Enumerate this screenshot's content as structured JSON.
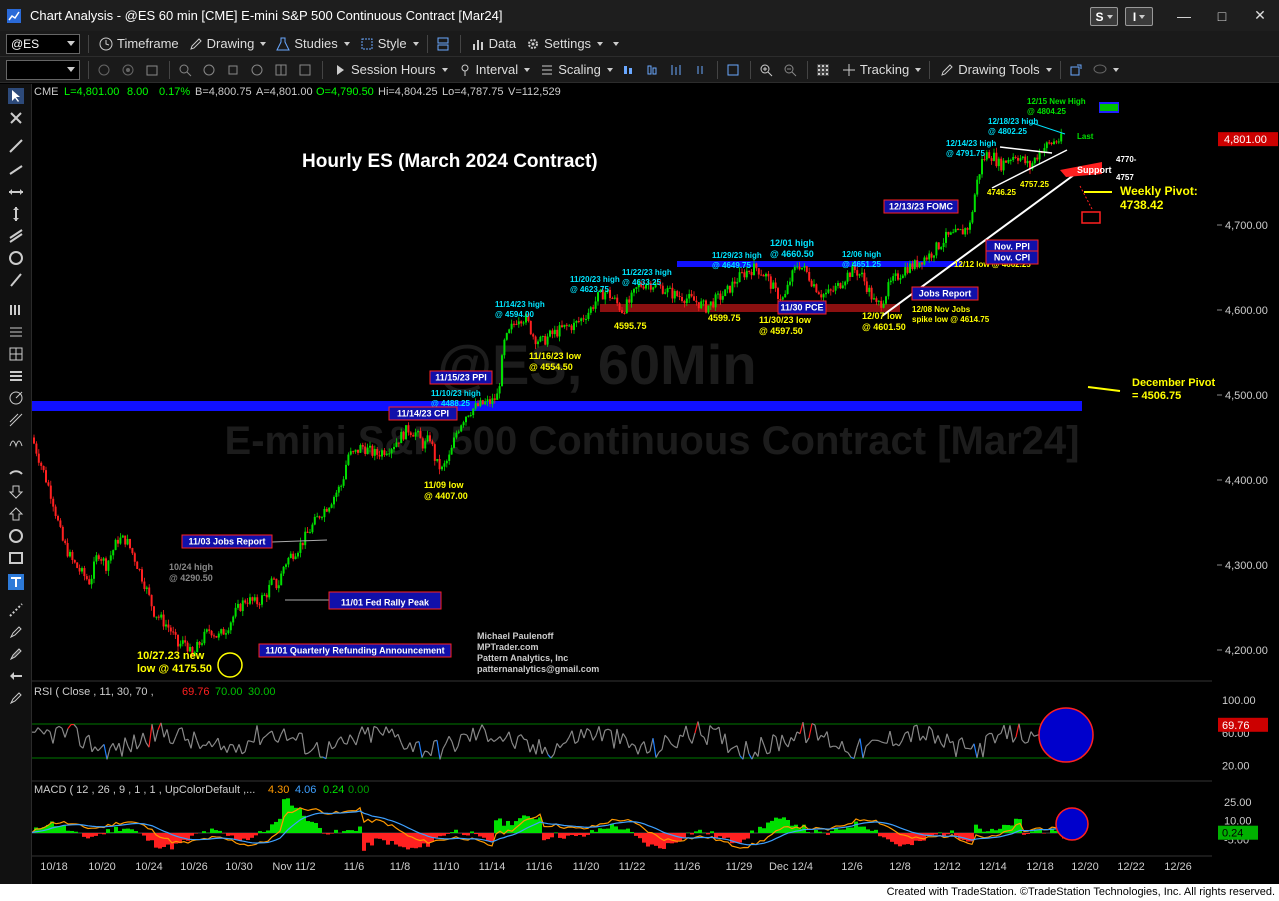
{
  "window": {
    "title": "Chart Analysis - @ES 60 min [CME] E-mini S&P 500 Continuous Contract [Mar24]",
    "s_button": "S",
    "i_button": "I"
  },
  "toolbar1": {
    "symbol": "@ES",
    "timeframe": "Timeframe",
    "drawing": "Drawing",
    "studies": "Studies",
    "style": "Style",
    "data": "Data",
    "settings": "Settings"
  },
  "toolbar2": {
    "session_hours": "Session Hours",
    "interval": "Interval",
    "scaling": "Scaling",
    "tracking": "Tracking",
    "drawing_tools": "Drawing Tools"
  },
  "header": {
    "exchange": "CME",
    "last": "L=4,801.00",
    "change": "8.00",
    "pct": "0.17%",
    "bid": "B=4,800.75",
    "ask": "A=4,801.00",
    "open": "O=4,790.50",
    "high": "Hi=4,804.25",
    "low": "Lo=4,787.75",
    "volume": "V=112,529"
  },
  "watermark": {
    "line1": "@ES, 60Min",
    "line2": "E-mini S&P 500 Continuous Contract [Mar24]"
  },
  "chart_data": {
    "type": "candlestick",
    "title": "Hourly ES (March 2024 Contract)",
    "price_axis": {
      "ticks": [
        "4,700.00",
        "4,600.00",
        "4,500.00",
        "4,400.00",
        "4,300.00",
        "4,200.00"
      ],
      "last_label": "4,801.00"
    },
    "x_axis_ticks": [
      "10/18",
      "10/20",
      "10/24",
      "10/26",
      "10/30",
      "Nov 11/2",
      "11/6",
      "11/8",
      "11/10",
      "11/14",
      "11/16",
      "11/20",
      "11/22",
      "11/26",
      "11/29",
      "Dec 12/4",
      "12/6",
      "12/8",
      "12/12",
      "12/14",
      "12/18",
      "12/20",
      "12/22",
      "12/26"
    ],
    "price_path": [
      [
        0,
        4450
      ],
      [
        10,
        4415
      ],
      [
        20,
        4380
      ],
      [
        30,
        4330
      ],
      [
        40,
        4305
      ],
      [
        50,
        4290
      ],
      [
        58,
        4280
      ],
      [
        66,
        4315
      ],
      [
        74,
        4300
      ],
      [
        86,
        4330
      ],
      [
        94,
        4330
      ],
      [
        102,
        4310
      ],
      [
        112,
        4280
      ],
      [
        122,
        4245
      ],
      [
        130,
        4235
      ],
      [
        138,
        4225
      ],
      [
        146,
        4205
      ],
      [
        154,
        4210
      ],
      [
        160,
        4190
      ],
      [
        166,
        4205
      ],
      [
        172,
        4215
      ],
      [
        178,
        4225
      ],
      [
        186,
        4215
      ],
      [
        194,
        4225
      ],
      [
        204,
        4245
      ],
      [
        214,
        4260
      ],
      [
        224,
        4255
      ],
      [
        234,
        4265
      ],
      [
        240,
        4280
      ],
      [
        246,
        4275
      ],
      [
        252,
        4300
      ],
      [
        258,
        4310
      ],
      [
        266,
        4320
      ],
      [
        272,
        4330
      ],
      [
        280,
        4345
      ],
      [
        288,
        4360
      ],
      [
        296,
        4370
      ],
      [
        304,
        4385
      ],
      [
        310,
        4395
      ],
      [
        316,
        4430
      ],
      [
        322,
        4430
      ],
      [
        330,
        4440
      ],
      [
        336,
        4435
      ],
      [
        344,
        4430
      ],
      [
        352,
        4435
      ],
      [
        360,
        4440
      ],
      [
        368,
        4450
      ],
      [
        376,
        4460
      ],
      [
        384,
        4455
      ],
      [
        392,
        4440
      ],
      [
        398,
        4450
      ],
      [
        404,
        4420
      ],
      [
        410,
        4412
      ],
      [
        418,
        4428
      ],
      [
        424,
        4455
      ],
      [
        430,
        4470
      ],
      [
        436,
        4480
      ],
      [
        444,
        4486
      ],
      [
        452,
        4490
      ],
      [
        460,
        4492
      ],
      [
        466,
        4500
      ],
      [
        472,
        4560
      ],
      [
        480,
        4580
      ],
      [
        486,
        4592
      ],
      [
        494,
        4590
      ],
      [
        502,
        4568
      ],
      [
        510,
        4562
      ],
      [
        518,
        4570
      ],
      [
        526,
        4575
      ],
      [
        534,
        4580
      ],
      [
        542,
        4582
      ],
      [
        550,
        4590
      ],
      [
        558,
        4600
      ],
      [
        566,
        4615
      ],
      [
        574,
        4622
      ],
      [
        582,
        4612
      ],
      [
        590,
        4600
      ],
      [
        598,
        4610
      ],
      [
        606,
        4628
      ],
      [
        614,
        4632
      ],
      [
        622,
        4630
      ],
      [
        632,
        4625
      ],
      [
        642,
        4618
      ],
      [
        652,
        4615
      ],
      [
        664,
        4610
      ],
      [
        674,
        4603
      ],
      [
        684,
        4612
      ],
      [
        694,
        4620
      ],
      [
        704,
        4635
      ],
      [
        714,
        4645
      ],
      [
        724,
        4650
      ],
      [
        734,
        4640
      ],
      [
        744,
        4620
      ],
      [
        752,
        4612
      ],
      [
        758,
        4635
      ],
      [
        766,
        4655
      ],
      [
        774,
        4645
      ],
      [
        782,
        4630
      ],
      [
        790,
        4618
      ],
      [
        798,
        4620
      ],
      [
        806,
        4628
      ],
      [
        814,
        4640
      ],
      [
        822,
        4648
      ],
      [
        830,
        4640
      ],
      [
        838,
        4620
      ],
      [
        844,
        4605
      ],
      [
        850,
        4610
      ],
      [
        858,
        4630
      ],
      [
        866,
        4640
      ],
      [
        874,
        4650
      ],
      [
        882,
        4652
      ],
      [
        890,
        4660
      ],
      [
        898,
        4665
      ],
      [
        906,
        4675
      ],
      [
        914,
        4685
      ],
      [
        922,
        4688
      ],
      [
        930,
        4692
      ],
      [
        938,
        4700
      ],
      [
        944,
        4745
      ],
      [
        950,
        4775
      ],
      [
        956,
        4785
      ],
      [
        962,
        4780
      ],
      [
        968,
        4770
      ],
      [
        976,
        4778
      ],
      [
        984,
        4783
      ],
      [
        992,
        4775
      ],
      [
        998,
        4768
      ],
      [
        1004,
        4780
      ],
      [
        1010,
        4790
      ],
      [
        1016,
        4794
      ],
      [
        1022,
        4798
      ],
      [
        1030,
        4801
      ]
    ],
    "annotations": {
      "a_1215_high": "12/15 New High\n@ 4804.25",
      "a_1218_high": "12/18/23 high\n@ 4802.25",
      "a_1214_high": "12/14/23 high\n@ 4791.75",
      "a_last": "Last",
      "a_4770": "4770-",
      "a_4757": "4757",
      "a_support": "Support",
      "a_4746": "4746.25",
      "a_47572": "4757.25",
      "a_weekly_pivot": "Weekly Pivot:\n4738.42",
      "a_fomc": "12/13/23 FOMC",
      "a_nov_ppi": "Nov. PPI",
      "a_nov_cpi": "Nov. CPI",
      "a_1212_low": "12/12 low @ 4662.25",
      "a_1201_high": "12/01 high\n@ 4660.50",
      "a_1206_high": "12/06 high\n@ 4651.25",
      "a_1129_high": "11/29/23 high\n@ 4649.75",
      "a_1120_high": "11/20/23 high\n@ 4623.75",
      "a_1122_high": "11/22/23 high\n@ 4633.25",
      "a_1114_high": "11/14/23 high\n@ 4594.00",
      "a_jobs_report": "Jobs Report",
      "a_1130_pce": "11/30 PCE",
      "a_4595": "4595.75",
      "a_4599": "4599.75",
      "a_1130_low": "11/30/23 low\n@ 4597.50",
      "a_1207_low": "12/07 low\n@ 4601.50",
      "a_1208_jobs": "12/08 Nov Jobs\nspike low @ 4614.75",
      "a_1116_low": "11/16/23 low\n@ 4554.50",
      "a_1115_ppi": "11/15/23 PPI",
      "a_1110_high": "11/10/23 high\n@ 4488.25",
      "a_1114_cpi": "11/14/23 CPI",
      "a_dec_pivot": "December Pivot\n= 4506.75",
      "a_1109_low": "11/09 low\n@ 4407.00",
      "a_1103_jobs": "11/03 Jobs Report",
      "a_1024_high": "10/24 high\n@ 4290.50",
      "a_1101_fed": "11/01 Fed Rally Peak",
      "a_1027_low": "10/27.23 new\nlow @ 4175.50",
      "a_1101_refund": "11/01 Quarterly Refunding Announcement",
      "a_credit": "Michael Paulenoff\nMPTrader.com\nPattern Analytics, Inc\npatternanalytics@gmail.com"
    },
    "rsi": {
      "label_prefix": "RSI ( Close , 11, 30, 70 ,",
      "v1": "69.76",
      "v2": "70.00",
      "v3": "30.00",
      "ticks": [
        "100.00",
        "60.00",
        "20.00"
      ],
      "last": "69.76"
    },
    "macd": {
      "label_prefix": "MACD ( 12 , 26 , 9 , 1 , 1 , UpColorDefault ,...",
      "v1": "4.30",
      "v2": "4.06",
      "v3": "0.24",
      "v4": "0.00",
      "ticks": [
        "25.00",
        "10.00",
        "-5.00"
      ],
      "last": "0.24"
    },
    "colors": {
      "up": "#00e000",
      "down": "#ff2020",
      "band_blue": "#1010ff",
      "band_red": "#8b1010",
      "annot_cyan": "#00e5ff",
      "annot_yellow": "#ffff00"
    }
  },
  "footer": "Created with TradeStation. ©TradeStation Technologies, Inc. All rights reserved."
}
